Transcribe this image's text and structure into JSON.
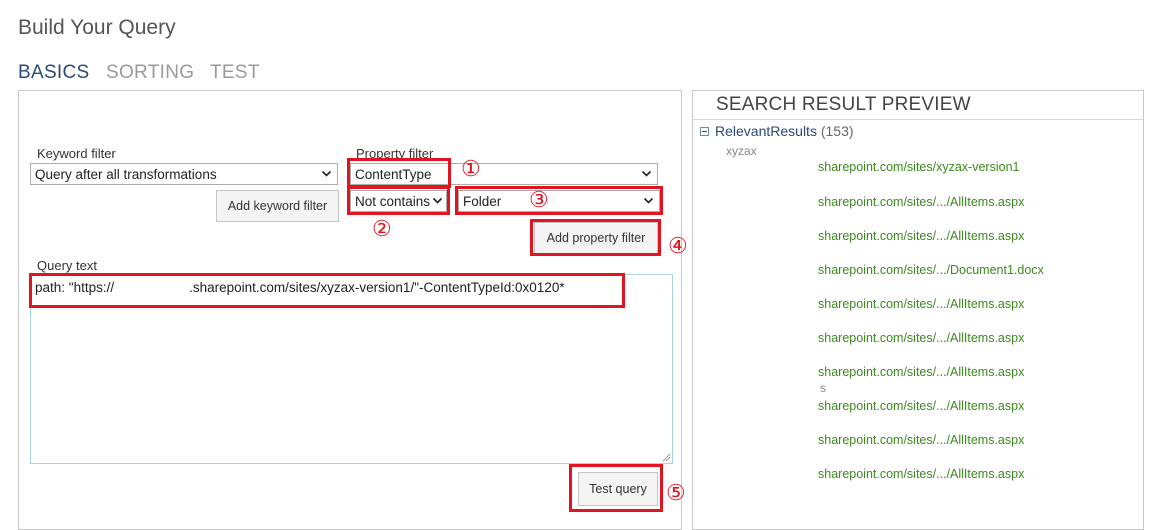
{
  "page": {
    "title": "Build Your Query"
  },
  "tabs": [
    {
      "label": "BASICS",
      "active": true
    },
    {
      "label": "SORTING",
      "active": false
    },
    {
      "label": "TEST",
      "active": false
    }
  ],
  "keyword_filter": {
    "label": "Keyword filter",
    "selected": "Query after all transformations",
    "add_button": "Add keyword filter"
  },
  "property_filter": {
    "label": "Property filter",
    "property_selected": "ContentType",
    "operator_selected": "Not contains",
    "value_selected": "Folder",
    "add_button": "Add property filter"
  },
  "query_text": {
    "label": "Query text",
    "value": "path: \"https://                    .sharepoint.com/sites/xyzax-version1/\"-ContentTypeId:0x0120*"
  },
  "test_button": "Test query",
  "callouts": [
    "①",
    "②",
    "③",
    "④",
    "⑤"
  ],
  "preview": {
    "title": "SEARCH RESULT PREVIEW",
    "group_name": "RelevantResults",
    "group_count": "(153)",
    "sub_label": "xyzax",
    "stray_char": "s",
    "results": [
      "sharepoint.com/sites/xyzax-version1",
      "sharepoint.com/sites/.../AllItems.aspx",
      "sharepoint.com/sites/.../AllItems.aspx",
      "sharepoint.com/sites/.../Document1.docx",
      "sharepoint.com/sites/.../AllItems.aspx",
      "sharepoint.com/sites/.../AllItems.aspx",
      "sharepoint.com/sites/.../AllItems.aspx",
      "sharepoint.com/sites/.../AllItems.aspx",
      "sharepoint.com/sites/.../AllItems.aspx",
      "sharepoint.com/sites/.../AllItems.aspx"
    ]
  },
  "colors": {
    "highlight": "#e1141f",
    "tab_active": "#2a4a7a",
    "result_link": "#3b8a1d"
  }
}
